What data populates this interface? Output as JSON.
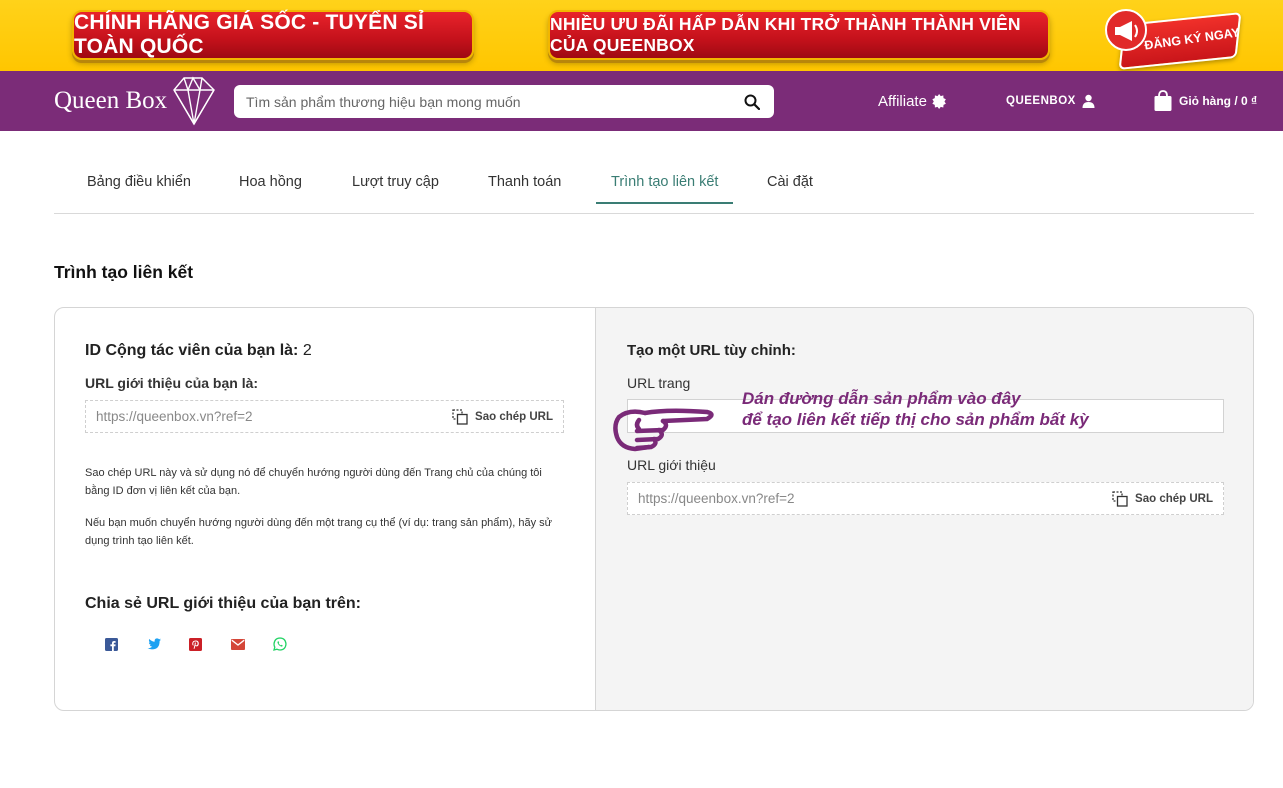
{
  "promo": {
    "banner_left": "CHÍNH HÃNG GIÁ SỐC - TUYỂN SỈ TOÀN QUỐC",
    "banner_right": "NHIỀU ƯU ĐÃI HẤP DẪN KHI TRỞ THÀNH THÀNH VIÊN CỦA QUEENBOX",
    "cta": "ĐĂNG KÝ NGAY"
  },
  "header": {
    "logo_text": "Queen Box",
    "search_placeholder": "Tìm sản phẩm thương hiệu bạn mong muốn",
    "affiliate": "Affiliate",
    "account": "QUEENBOX",
    "cart": "Giỏ hàng / 0 ₫"
  },
  "tabs": [
    {
      "label": "Bảng điều khiển",
      "active": false
    },
    {
      "label": "Hoa hồng",
      "active": false
    },
    {
      "label": "Lượt truy cập",
      "active": false
    },
    {
      "label": "Thanh toán",
      "active": false
    },
    {
      "label": "Trình tạo liên kết",
      "active": true
    },
    {
      "label": "Cài đặt",
      "active": false
    }
  ],
  "page_title": "Trình tạo liên kết",
  "left": {
    "affiliate_id_label": "ID Cộng tác viên của bạn là:",
    "affiliate_id_value": "2",
    "referral_url_label": "URL giới thiệu của bạn là:",
    "referral_url": "https://queenbox.vn?ref=2",
    "copy_label": "Sao chép URL",
    "help_1": "Sao chép URL này và sử dụng nó để chuyển hướng người dùng đến Trang chủ của chúng tôi bằng ID đơn vị liên kết của bạn.",
    "help_2": "Nếu bạn muốn chuyển hướng người dùng đến một trang cụ thể (ví dụ: trang sản phẩm), hãy sử dụng trình tạo liên kết.",
    "share_title": "Chia sẻ URL giới thiệu của bạn trên:",
    "share_icons": [
      "facebook-icon",
      "twitter-icon",
      "pinterest-icon",
      "email-icon",
      "whatsapp-icon"
    ]
  },
  "right": {
    "title": "Tạo một URL tùy chỉnh:",
    "page_url_label": "URL trang",
    "page_url_value": "",
    "referral_url_label": "URL giới thiệu",
    "referral_url": "https://queenbox.vn?ref=2",
    "copy_label": "Sao chép URL",
    "hint_line_1": "Dán đường dẫn sản phẩm vào đây",
    "hint_line_2": "để tạo liên kết tiếp thị cho sản phẩm bất kỳ"
  },
  "colors": {
    "header_bg": "#7b2c78",
    "promo_bg": "#ffc600",
    "promo_pill": "#d01820",
    "tab_active": "#3a7d74",
    "hint_text": "#7a2a78",
    "facebook": "#3b5998",
    "twitter": "#1da1f2",
    "pinterest": "#cb2027",
    "email": "#d44638",
    "whatsapp": "#25d366"
  }
}
